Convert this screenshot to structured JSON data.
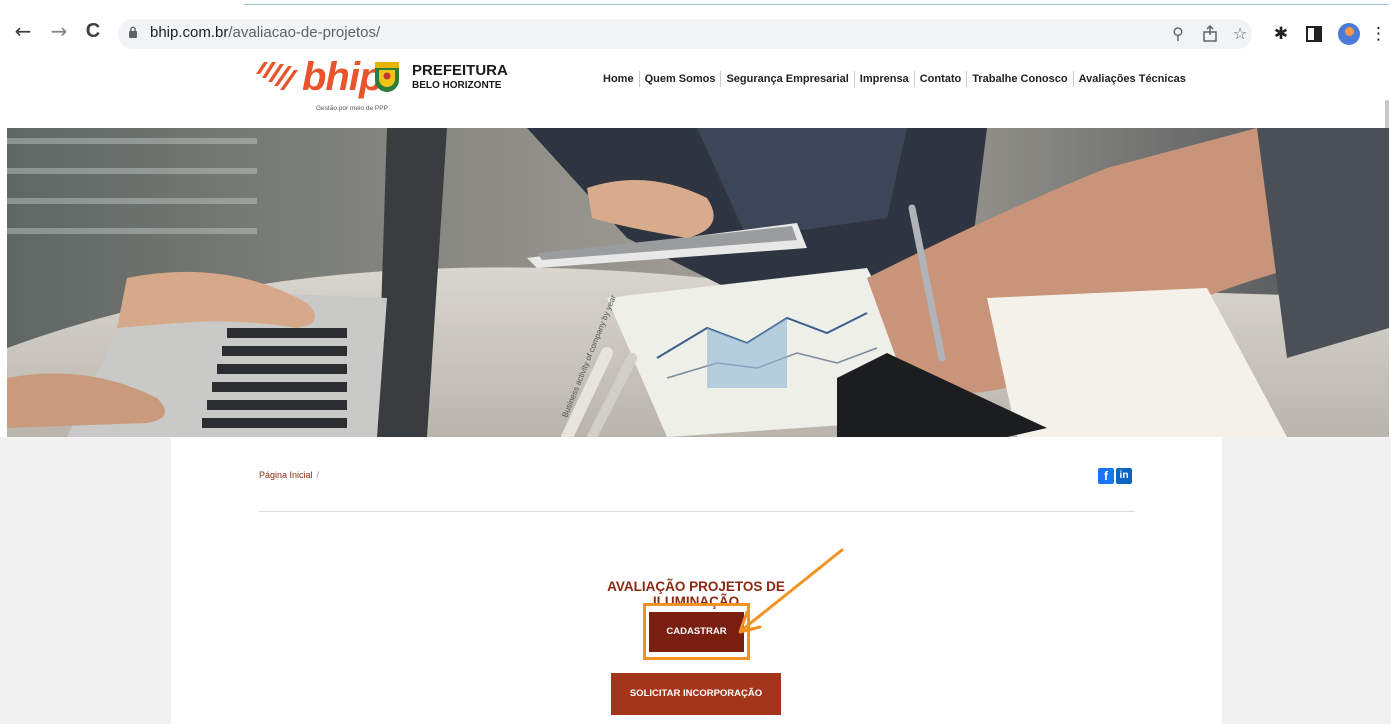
{
  "browser": {
    "back_glyph": "←",
    "forward_glyph": "→",
    "reload_glyph": "C",
    "url_domain": "bhip.com.br",
    "url_path": "/avaliacao-de-projetos/",
    "icons": [
      "zoom-icon",
      "share-icon",
      "star-icon",
      "extensions-icon",
      "side-panel-icon",
      "profile-avatar",
      "menu-icon"
    ]
  },
  "header": {
    "logo_text": "bhip",
    "prefeitura_title": "PREFEITURA",
    "prefeitura_sub": "BELO HORIZONTE",
    "tagline": "Gestão por meio de PPP",
    "nav": [
      "Home",
      "Quem Somos",
      "Segurança Empresarial",
      "Imprensa",
      "Contato",
      "Trabalhe Conosco",
      "Avaliações Técnicas"
    ]
  },
  "hero": {
    "chart_caption": "Business activity of company by year"
  },
  "content": {
    "breadcrumb_home": "Página Inicial",
    "breadcrumb_sep": "/",
    "facebook_label": "f",
    "linkedin_label": "in",
    "section_title": "AVALIAÇÃO PROJETOS DE ILUMINAÇÃO",
    "cadastrar_label": "CADASTRAR",
    "solicitar_label": "SOLICITAR INCORPORAÇÃO"
  },
  "colors": {
    "brand_orange": "#e8542b",
    "button_dark": "#7a1e10",
    "button_brick": "#a3351b",
    "highlight": "#f39222"
  }
}
